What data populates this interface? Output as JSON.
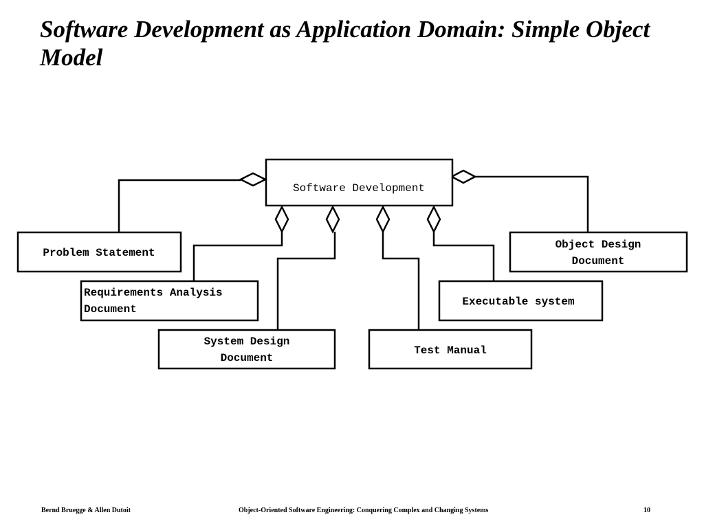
{
  "title": "Software Development as Application Domain: Simple Object Model",
  "diagram": {
    "root": "Software Development",
    "parts": {
      "problem_statement": [
        "Problem Statement"
      ],
      "requirements_analysis": [
        "Requirements Analysis",
        "Document"
      ],
      "system_design": [
        "System Design",
        "Document"
      ],
      "test_manual": [
        "Test Manual"
      ],
      "executable_system": [
        "Executable system"
      ],
      "object_design": [
        "Object Design",
        "Document"
      ]
    }
  },
  "footer": {
    "authors": "Bernd Bruegge & Allen Dutoit",
    "book": "Object-Oriented Software Engineering: Conquering Complex and Changing Systems",
    "page": "10"
  }
}
